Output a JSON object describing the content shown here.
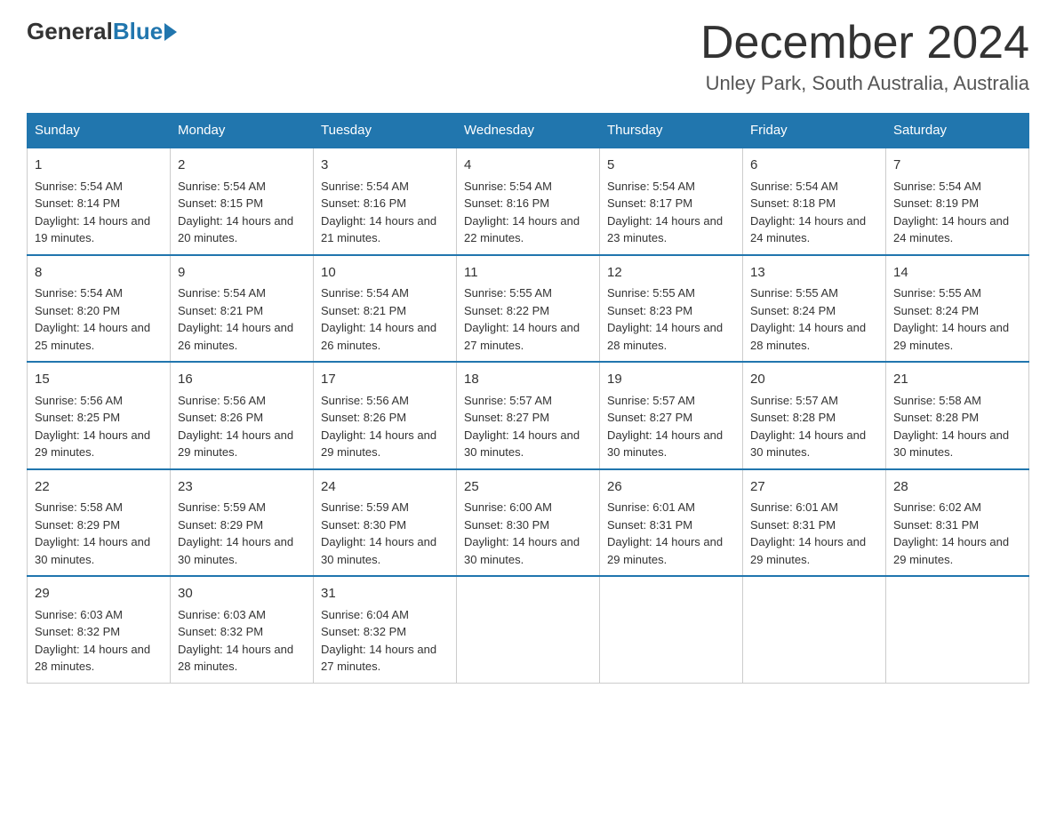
{
  "header": {
    "logo": {
      "general": "General",
      "blue": "Blue"
    },
    "title": "December 2024",
    "location": "Unley Park, South Australia, Australia"
  },
  "weekdays": [
    "Sunday",
    "Monday",
    "Tuesday",
    "Wednesday",
    "Thursday",
    "Friday",
    "Saturday"
  ],
  "weeks": [
    [
      {
        "day": "1",
        "sunrise": "5:54 AM",
        "sunset": "8:14 PM",
        "daylight": "14 hours and 19 minutes."
      },
      {
        "day": "2",
        "sunrise": "5:54 AM",
        "sunset": "8:15 PM",
        "daylight": "14 hours and 20 minutes."
      },
      {
        "day": "3",
        "sunrise": "5:54 AM",
        "sunset": "8:16 PM",
        "daylight": "14 hours and 21 minutes."
      },
      {
        "day": "4",
        "sunrise": "5:54 AM",
        "sunset": "8:16 PM",
        "daylight": "14 hours and 22 minutes."
      },
      {
        "day": "5",
        "sunrise": "5:54 AM",
        "sunset": "8:17 PM",
        "daylight": "14 hours and 23 minutes."
      },
      {
        "day": "6",
        "sunrise": "5:54 AM",
        "sunset": "8:18 PM",
        "daylight": "14 hours and 24 minutes."
      },
      {
        "day": "7",
        "sunrise": "5:54 AM",
        "sunset": "8:19 PM",
        "daylight": "14 hours and 24 minutes."
      }
    ],
    [
      {
        "day": "8",
        "sunrise": "5:54 AM",
        "sunset": "8:20 PM",
        "daylight": "14 hours and 25 minutes."
      },
      {
        "day": "9",
        "sunrise": "5:54 AM",
        "sunset": "8:21 PM",
        "daylight": "14 hours and 26 minutes."
      },
      {
        "day": "10",
        "sunrise": "5:54 AM",
        "sunset": "8:21 PM",
        "daylight": "14 hours and 26 minutes."
      },
      {
        "day": "11",
        "sunrise": "5:55 AM",
        "sunset": "8:22 PM",
        "daylight": "14 hours and 27 minutes."
      },
      {
        "day": "12",
        "sunrise": "5:55 AM",
        "sunset": "8:23 PM",
        "daylight": "14 hours and 28 minutes."
      },
      {
        "day": "13",
        "sunrise": "5:55 AM",
        "sunset": "8:24 PM",
        "daylight": "14 hours and 28 minutes."
      },
      {
        "day": "14",
        "sunrise": "5:55 AM",
        "sunset": "8:24 PM",
        "daylight": "14 hours and 29 minutes."
      }
    ],
    [
      {
        "day": "15",
        "sunrise": "5:56 AM",
        "sunset": "8:25 PM",
        "daylight": "14 hours and 29 minutes."
      },
      {
        "day": "16",
        "sunrise": "5:56 AM",
        "sunset": "8:26 PM",
        "daylight": "14 hours and 29 minutes."
      },
      {
        "day": "17",
        "sunrise": "5:56 AM",
        "sunset": "8:26 PM",
        "daylight": "14 hours and 29 minutes."
      },
      {
        "day": "18",
        "sunrise": "5:57 AM",
        "sunset": "8:27 PM",
        "daylight": "14 hours and 30 minutes."
      },
      {
        "day": "19",
        "sunrise": "5:57 AM",
        "sunset": "8:27 PM",
        "daylight": "14 hours and 30 minutes."
      },
      {
        "day": "20",
        "sunrise": "5:57 AM",
        "sunset": "8:28 PM",
        "daylight": "14 hours and 30 minutes."
      },
      {
        "day": "21",
        "sunrise": "5:58 AM",
        "sunset": "8:28 PM",
        "daylight": "14 hours and 30 minutes."
      }
    ],
    [
      {
        "day": "22",
        "sunrise": "5:58 AM",
        "sunset": "8:29 PM",
        "daylight": "14 hours and 30 minutes."
      },
      {
        "day": "23",
        "sunrise": "5:59 AM",
        "sunset": "8:29 PM",
        "daylight": "14 hours and 30 minutes."
      },
      {
        "day": "24",
        "sunrise": "5:59 AM",
        "sunset": "8:30 PM",
        "daylight": "14 hours and 30 minutes."
      },
      {
        "day": "25",
        "sunrise": "6:00 AM",
        "sunset": "8:30 PM",
        "daylight": "14 hours and 30 minutes."
      },
      {
        "day": "26",
        "sunrise": "6:01 AM",
        "sunset": "8:31 PM",
        "daylight": "14 hours and 29 minutes."
      },
      {
        "day": "27",
        "sunrise": "6:01 AM",
        "sunset": "8:31 PM",
        "daylight": "14 hours and 29 minutes."
      },
      {
        "day": "28",
        "sunrise": "6:02 AM",
        "sunset": "8:31 PM",
        "daylight": "14 hours and 29 minutes."
      }
    ],
    [
      {
        "day": "29",
        "sunrise": "6:03 AM",
        "sunset": "8:32 PM",
        "daylight": "14 hours and 28 minutes."
      },
      {
        "day": "30",
        "sunrise": "6:03 AM",
        "sunset": "8:32 PM",
        "daylight": "14 hours and 28 minutes."
      },
      {
        "day": "31",
        "sunrise": "6:04 AM",
        "sunset": "8:32 PM",
        "daylight": "14 hours and 27 minutes."
      },
      null,
      null,
      null,
      null
    ]
  ]
}
